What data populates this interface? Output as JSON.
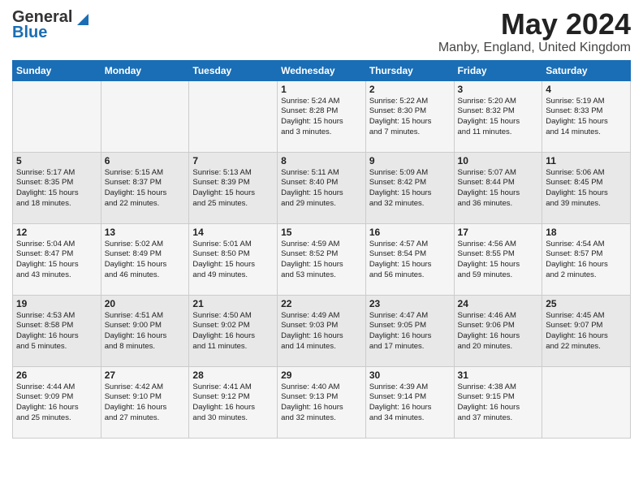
{
  "header": {
    "logo_general": "General",
    "logo_blue": "Blue",
    "month": "May 2024",
    "location": "Manby, England, United Kingdom"
  },
  "days_of_week": [
    "Sunday",
    "Monday",
    "Tuesday",
    "Wednesday",
    "Thursday",
    "Friday",
    "Saturday"
  ],
  "weeks": [
    [
      {
        "day": "",
        "content": ""
      },
      {
        "day": "",
        "content": ""
      },
      {
        "day": "",
        "content": ""
      },
      {
        "day": "1",
        "content": "Sunrise: 5:24 AM\nSunset: 8:28 PM\nDaylight: 15 hours\nand 3 minutes."
      },
      {
        "day": "2",
        "content": "Sunrise: 5:22 AM\nSunset: 8:30 PM\nDaylight: 15 hours\nand 7 minutes."
      },
      {
        "day": "3",
        "content": "Sunrise: 5:20 AM\nSunset: 8:32 PM\nDaylight: 15 hours\nand 11 minutes."
      },
      {
        "day": "4",
        "content": "Sunrise: 5:19 AM\nSunset: 8:33 PM\nDaylight: 15 hours\nand 14 minutes."
      }
    ],
    [
      {
        "day": "5",
        "content": "Sunrise: 5:17 AM\nSunset: 8:35 PM\nDaylight: 15 hours\nand 18 minutes."
      },
      {
        "day": "6",
        "content": "Sunrise: 5:15 AM\nSunset: 8:37 PM\nDaylight: 15 hours\nand 22 minutes."
      },
      {
        "day": "7",
        "content": "Sunrise: 5:13 AM\nSunset: 8:39 PM\nDaylight: 15 hours\nand 25 minutes."
      },
      {
        "day": "8",
        "content": "Sunrise: 5:11 AM\nSunset: 8:40 PM\nDaylight: 15 hours\nand 29 minutes."
      },
      {
        "day": "9",
        "content": "Sunrise: 5:09 AM\nSunset: 8:42 PM\nDaylight: 15 hours\nand 32 minutes."
      },
      {
        "day": "10",
        "content": "Sunrise: 5:07 AM\nSunset: 8:44 PM\nDaylight: 15 hours\nand 36 minutes."
      },
      {
        "day": "11",
        "content": "Sunrise: 5:06 AM\nSunset: 8:45 PM\nDaylight: 15 hours\nand 39 minutes."
      }
    ],
    [
      {
        "day": "12",
        "content": "Sunrise: 5:04 AM\nSunset: 8:47 PM\nDaylight: 15 hours\nand 43 minutes."
      },
      {
        "day": "13",
        "content": "Sunrise: 5:02 AM\nSunset: 8:49 PM\nDaylight: 15 hours\nand 46 minutes."
      },
      {
        "day": "14",
        "content": "Sunrise: 5:01 AM\nSunset: 8:50 PM\nDaylight: 15 hours\nand 49 minutes."
      },
      {
        "day": "15",
        "content": "Sunrise: 4:59 AM\nSunset: 8:52 PM\nDaylight: 15 hours\nand 53 minutes."
      },
      {
        "day": "16",
        "content": "Sunrise: 4:57 AM\nSunset: 8:54 PM\nDaylight: 15 hours\nand 56 minutes."
      },
      {
        "day": "17",
        "content": "Sunrise: 4:56 AM\nSunset: 8:55 PM\nDaylight: 15 hours\nand 59 minutes."
      },
      {
        "day": "18",
        "content": "Sunrise: 4:54 AM\nSunset: 8:57 PM\nDaylight: 16 hours\nand 2 minutes."
      }
    ],
    [
      {
        "day": "19",
        "content": "Sunrise: 4:53 AM\nSunset: 8:58 PM\nDaylight: 16 hours\nand 5 minutes."
      },
      {
        "day": "20",
        "content": "Sunrise: 4:51 AM\nSunset: 9:00 PM\nDaylight: 16 hours\nand 8 minutes."
      },
      {
        "day": "21",
        "content": "Sunrise: 4:50 AM\nSunset: 9:02 PM\nDaylight: 16 hours\nand 11 minutes."
      },
      {
        "day": "22",
        "content": "Sunrise: 4:49 AM\nSunset: 9:03 PM\nDaylight: 16 hours\nand 14 minutes."
      },
      {
        "day": "23",
        "content": "Sunrise: 4:47 AM\nSunset: 9:05 PM\nDaylight: 16 hours\nand 17 minutes."
      },
      {
        "day": "24",
        "content": "Sunrise: 4:46 AM\nSunset: 9:06 PM\nDaylight: 16 hours\nand 20 minutes."
      },
      {
        "day": "25",
        "content": "Sunrise: 4:45 AM\nSunset: 9:07 PM\nDaylight: 16 hours\nand 22 minutes."
      }
    ],
    [
      {
        "day": "26",
        "content": "Sunrise: 4:44 AM\nSunset: 9:09 PM\nDaylight: 16 hours\nand 25 minutes."
      },
      {
        "day": "27",
        "content": "Sunrise: 4:42 AM\nSunset: 9:10 PM\nDaylight: 16 hours\nand 27 minutes."
      },
      {
        "day": "28",
        "content": "Sunrise: 4:41 AM\nSunset: 9:12 PM\nDaylight: 16 hours\nand 30 minutes."
      },
      {
        "day": "29",
        "content": "Sunrise: 4:40 AM\nSunset: 9:13 PM\nDaylight: 16 hours\nand 32 minutes."
      },
      {
        "day": "30",
        "content": "Sunrise: 4:39 AM\nSunset: 9:14 PM\nDaylight: 16 hours\nand 34 minutes."
      },
      {
        "day": "31",
        "content": "Sunrise: 4:38 AM\nSunset: 9:15 PM\nDaylight: 16 hours\nand 37 minutes."
      },
      {
        "day": "",
        "content": ""
      }
    ]
  ]
}
